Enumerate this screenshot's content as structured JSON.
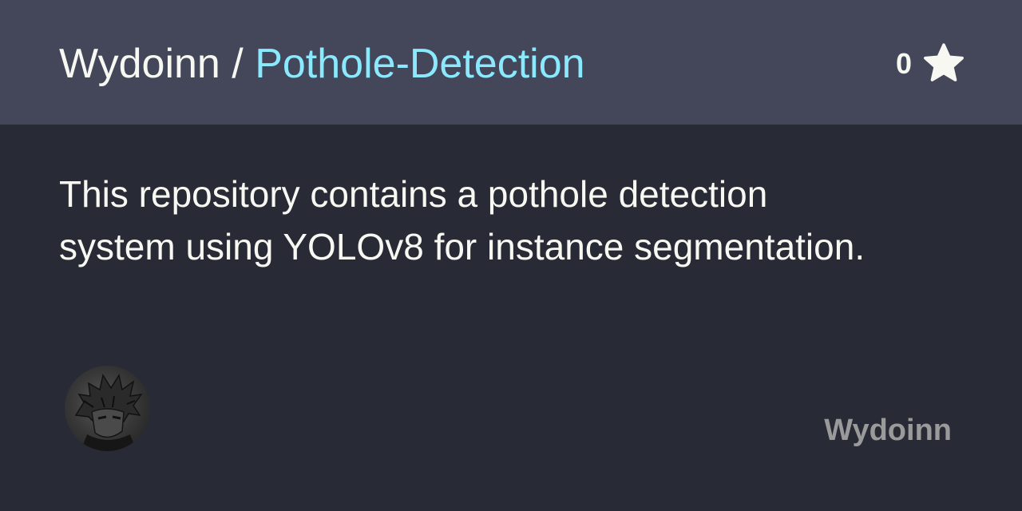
{
  "header": {
    "owner": "Wydoinn",
    "separator": " / ",
    "repo_name": "Pothole-Detection",
    "star_count": "0",
    "star_icon": "star-icon"
  },
  "description": "This repository contains a pothole detection system using YOLOv8 for instance segmentation.",
  "footer": {
    "avatar_icon": "avatar",
    "owner_label": "Wydoinn"
  },
  "colors": {
    "header_bg": "#44475a",
    "body_bg": "#282a36",
    "repo_name": "#8be9fd",
    "text": "#f8f8f2",
    "owner_label": "#9a9a9a"
  }
}
